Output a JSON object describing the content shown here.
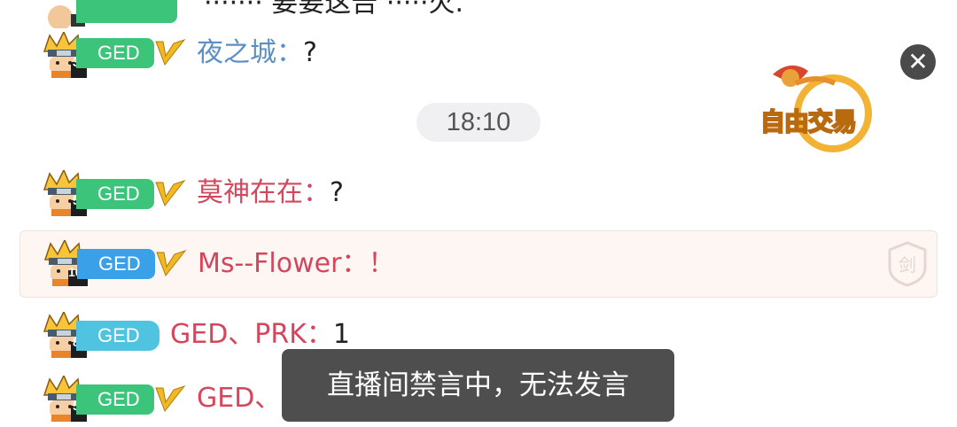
{
  "top_partial": {
    "text": "······· 要要这告 ·····火."
  },
  "messages": [
    {
      "level": "3",
      "badge": "GED",
      "name": "夜之城：",
      "text": "?"
    },
    {
      "level": "5",
      "badge": "GED",
      "name": "莫神在在：",
      "text": "?"
    },
    {
      "level": "10",
      "badge": "GED",
      "name": "Ms--Flower：",
      "text": "！"
    },
    {
      "level": "8",
      "badge": "GED",
      "name": "GED、PRK：",
      "text": "1"
    },
    {
      "level": "5",
      "badge": "GED",
      "name": "GED、野猿：",
      "text": "?"
    }
  ],
  "timestamp": "18:10",
  "trade_button": {
    "label": "自由交易"
  },
  "toast": "直播间禁言中，无法发言",
  "sword_badge_char": "剑",
  "colors": {
    "badge_green": "#3cc47a",
    "badge_blue": "#3aa0e8",
    "badge_cyan": "#4fc3e0",
    "vip_gold": "#f2b823"
  }
}
